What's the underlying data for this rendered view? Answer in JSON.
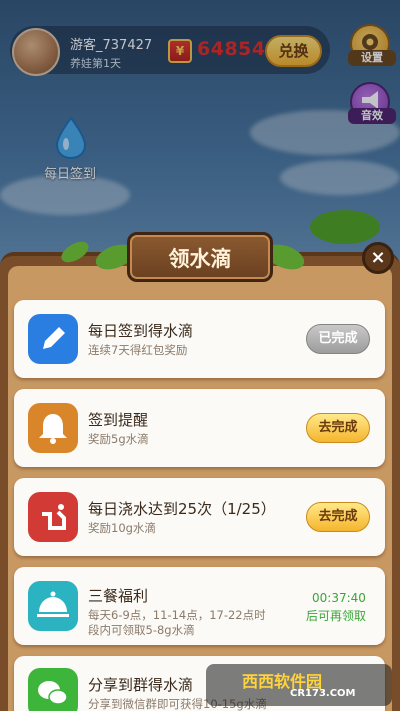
{
  "user": {
    "name": "游客_737427",
    "level": "养娃第1天"
  },
  "currency": {
    "icon_char": "¥",
    "amount": "64854",
    "exchange_label": "兑换"
  },
  "side_buttons": {
    "settings_label": "设置",
    "sound_label": "音效"
  },
  "checkin": {
    "label": "每日签到"
  },
  "panel": {
    "title": "领水滴",
    "close_symbol": "×"
  },
  "tasks": [
    {
      "title": "每日签到得水滴",
      "subtitle": "连续7天得红包奖励",
      "button": "已完成",
      "state": "done",
      "icon": "pencil-icon",
      "color": "#2a7de1"
    },
    {
      "title": "签到提醒",
      "subtitle": "奖励5g水滴",
      "button": "去完成",
      "state": "todo",
      "icon": "bell-icon",
      "color": "#d9852a"
    },
    {
      "title": "每日浇水达到25次（1/25）",
      "subtitle": "奖励10g水滴",
      "button": "去完成",
      "state": "todo",
      "icon": "watering-icon",
      "color": "#d23a35"
    },
    {
      "title": "三餐福利",
      "subtitle_line1": "每天6-9点，11-14点，17-22点时",
      "subtitle_line2": "段内可领取5-8g水滴",
      "timer": "00:37:40",
      "timer_note": "后可再领取",
      "icon": "meal-cover-icon",
      "color": "#2bb3c2"
    },
    {
      "title": "分享到群得水滴",
      "subtitle": "分享到微信群即可获得10-15g水滴",
      "icon": "wechat-icon",
      "color": "#3cb53a"
    }
  ],
  "watermark": {
    "text": "西西软件园",
    "sub": "CR173.COM"
  },
  "colors": {
    "panel_brown": "#7a4d2a",
    "coin_red": "#e22b25",
    "timer_green": "#3aa53a",
    "button_gold": "#f5b52d"
  }
}
